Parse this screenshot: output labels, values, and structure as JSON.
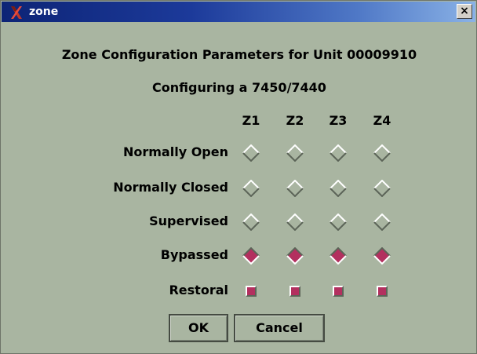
{
  "window": {
    "title": "zone",
    "close_label": "×"
  },
  "header": {
    "title": "Zone Configuration Parameters for Unit 00009910",
    "subtitle": "Configuring a 7450/7440"
  },
  "grid": {
    "columns": [
      "Z1",
      "Z2",
      "Z3",
      "Z4"
    ],
    "rows": [
      {
        "label": "Normally Open",
        "control": "radio",
        "states": [
          false,
          false,
          false,
          false
        ]
      },
      {
        "label": "Normally Closed",
        "control": "radio",
        "states": [
          false,
          false,
          false,
          false
        ]
      },
      {
        "label": "Supervised",
        "control": "radio",
        "states": [
          false,
          false,
          false,
          false
        ]
      },
      {
        "label": "Bypassed",
        "control": "radio",
        "states": [
          true,
          true,
          true,
          true
        ]
      },
      {
        "label": "Restoral",
        "control": "checkbox",
        "states": [
          true,
          true,
          true,
          true
        ]
      }
    ]
  },
  "buttons": {
    "ok_label": "OK",
    "cancel_label": "Cancel"
  },
  "colors": {
    "window_bg": "#a9b5a1",
    "selected": "#b3305f",
    "titlebar_start": "#0d2476",
    "titlebar_end": "#8ab2e6"
  }
}
